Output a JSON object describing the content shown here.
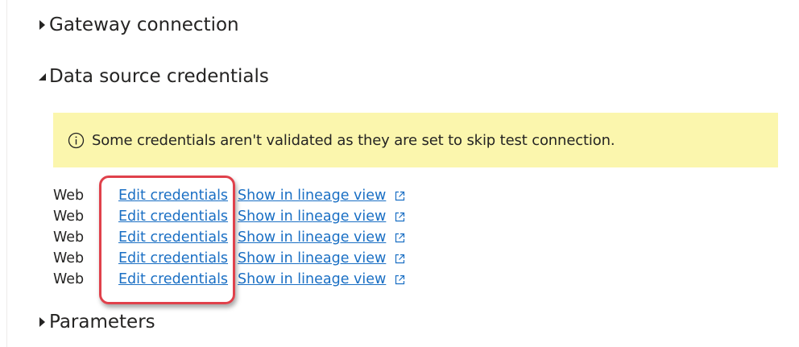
{
  "sections": {
    "gateway": {
      "title": "Gateway connection",
      "expanded": false
    },
    "credentials": {
      "title": "Data source credentials",
      "expanded": true
    },
    "parameters": {
      "title": "Parameters",
      "expanded": false
    }
  },
  "banner": {
    "icon": "info-icon",
    "message": "Some credentials aren't validated as they are set to skip test connection.",
    "background": "#fbf6ad"
  },
  "credentials": [
    {
      "type": "Web",
      "edit_label": "Edit credentials",
      "lineage_label": "Show in lineage view",
      "lineage_icon": "external-link-icon"
    },
    {
      "type": "Web",
      "edit_label": "Edit credentials",
      "lineage_label": "Show in lineage view",
      "lineage_icon": "external-link-icon"
    },
    {
      "type": "Web",
      "edit_label": "Edit credentials",
      "lineage_label": "Show in lineage view",
      "lineage_icon": "external-link-icon"
    },
    {
      "type": "Web",
      "edit_label": "Edit credentials",
      "lineage_label": "Show in lineage view",
      "lineage_icon": "external-link-icon"
    },
    {
      "type": "Web",
      "edit_label": "Edit credentials",
      "lineage_label": "Show in lineage view",
      "lineage_icon": "external-link-icon"
    }
  ],
  "colors": {
    "link": "#1a6fc4",
    "highlight": "#e0414b",
    "text": "#252423"
  }
}
